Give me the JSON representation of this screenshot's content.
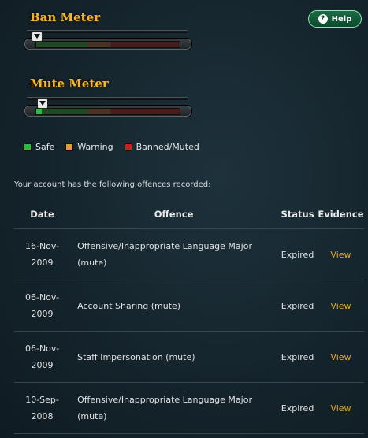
{
  "ban_meter": {
    "title": "Ban Meter",
    "level": 0.0
  },
  "mute_meter": {
    "title": "Mute Meter",
    "level": 0.04
  },
  "help_button": {
    "icon": "?",
    "label": "Help"
  },
  "legend": [
    {
      "label": "Safe",
      "color": "#2bbb3d"
    },
    {
      "label": "Warning",
      "color": "#e89a2a"
    },
    {
      "label": "Banned/Muted",
      "color": "#d81a1a"
    }
  ],
  "intro_text": "Your account has the following offences recorded:",
  "table": {
    "headers": {
      "date": "Date",
      "offence": "Offence",
      "status": "Status",
      "evidence": "Evidence"
    },
    "rows": [
      {
        "date_day": "16-Nov-",
        "date_year": "2009",
        "offence_line1": "Offensive/Inappropriate Language Major",
        "offence_line2": "(mute)",
        "status": "Expired",
        "evidence": "View"
      },
      {
        "date_day": "06-Nov-",
        "date_year": "2009",
        "offence_line1": "Account Sharing (mute)",
        "offence_line2": "",
        "status": "Expired",
        "evidence": "View"
      },
      {
        "date_day": "06-Nov-",
        "date_year": "2009",
        "offence_line1": "Staff Impersonation (mute)",
        "offence_line2": "",
        "status": "Expired",
        "evidence": "View"
      },
      {
        "date_day": "10-Sep-",
        "date_year": "2008",
        "offence_line1": "Offensive/Inappropriate Language Major",
        "offence_line2": "(mute)",
        "status": "Expired",
        "evidence": "View"
      }
    ]
  }
}
